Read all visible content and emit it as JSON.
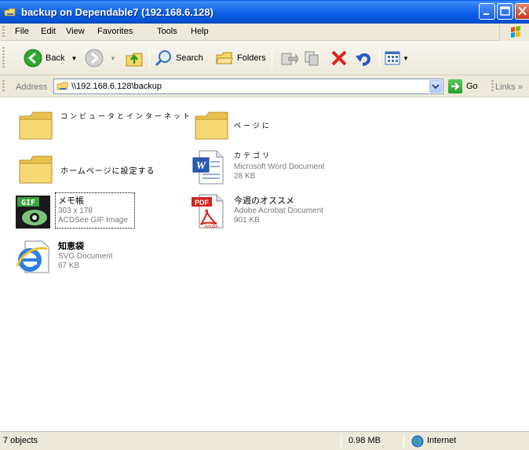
{
  "window": {
    "title": "backup on Dependable7 (192.168.6.128)"
  },
  "menubar": {
    "items": [
      "File",
      "Edit",
      "View",
      "Favorites",
      "Tools",
      "Help"
    ]
  },
  "toolbar": {
    "back_label": "Back",
    "search_label": "Search",
    "folders_label": "Folders"
  },
  "addressbar": {
    "label": "Address",
    "value": "\\\\192.168.6.128\\backup",
    "go_label": "Go",
    "links_label": "Links"
  },
  "items": [
    {
      "name": "コンピュータとインターネット",
      "type": "folder"
    },
    {
      "name": "ページに",
      "type": "folder"
    },
    {
      "name": "ホームページに設定する",
      "type": "folder"
    },
    {
      "name": "カテゴリ",
      "type": "word",
      "kind": "Microsoft Word Document",
      "size": "28 KB"
    },
    {
      "name": "メモ帳",
      "type": "gif",
      "kind": "303 x 178",
      "size": "ACDSee GIF Image"
    },
    {
      "name": "今週のオススメ",
      "type": "pdf",
      "kind": "Adobe Acrobat Document",
      "size": "901 KB"
    },
    {
      "name": "知恵袋",
      "type": "svg",
      "kind": "SVG Document",
      "size": "67 KB"
    }
  ],
  "statusbar": {
    "objects": "7 objects",
    "size": "0.98 MB",
    "zone": "Internet"
  },
  "icons": {
    "back": "back-arrow-icon",
    "forward": "forward-arrow-icon",
    "up": "up-folder-icon",
    "search": "search-icon",
    "folders": "folders-icon",
    "move": "move-to-icon",
    "copy": "copy-to-icon",
    "delete": "delete-icon",
    "undo": "undo-icon",
    "views": "views-icon"
  },
  "colors": {
    "titlebar": "#0a5ee8",
    "chrome": "#ece9d8",
    "folder": "#f3d56b"
  }
}
